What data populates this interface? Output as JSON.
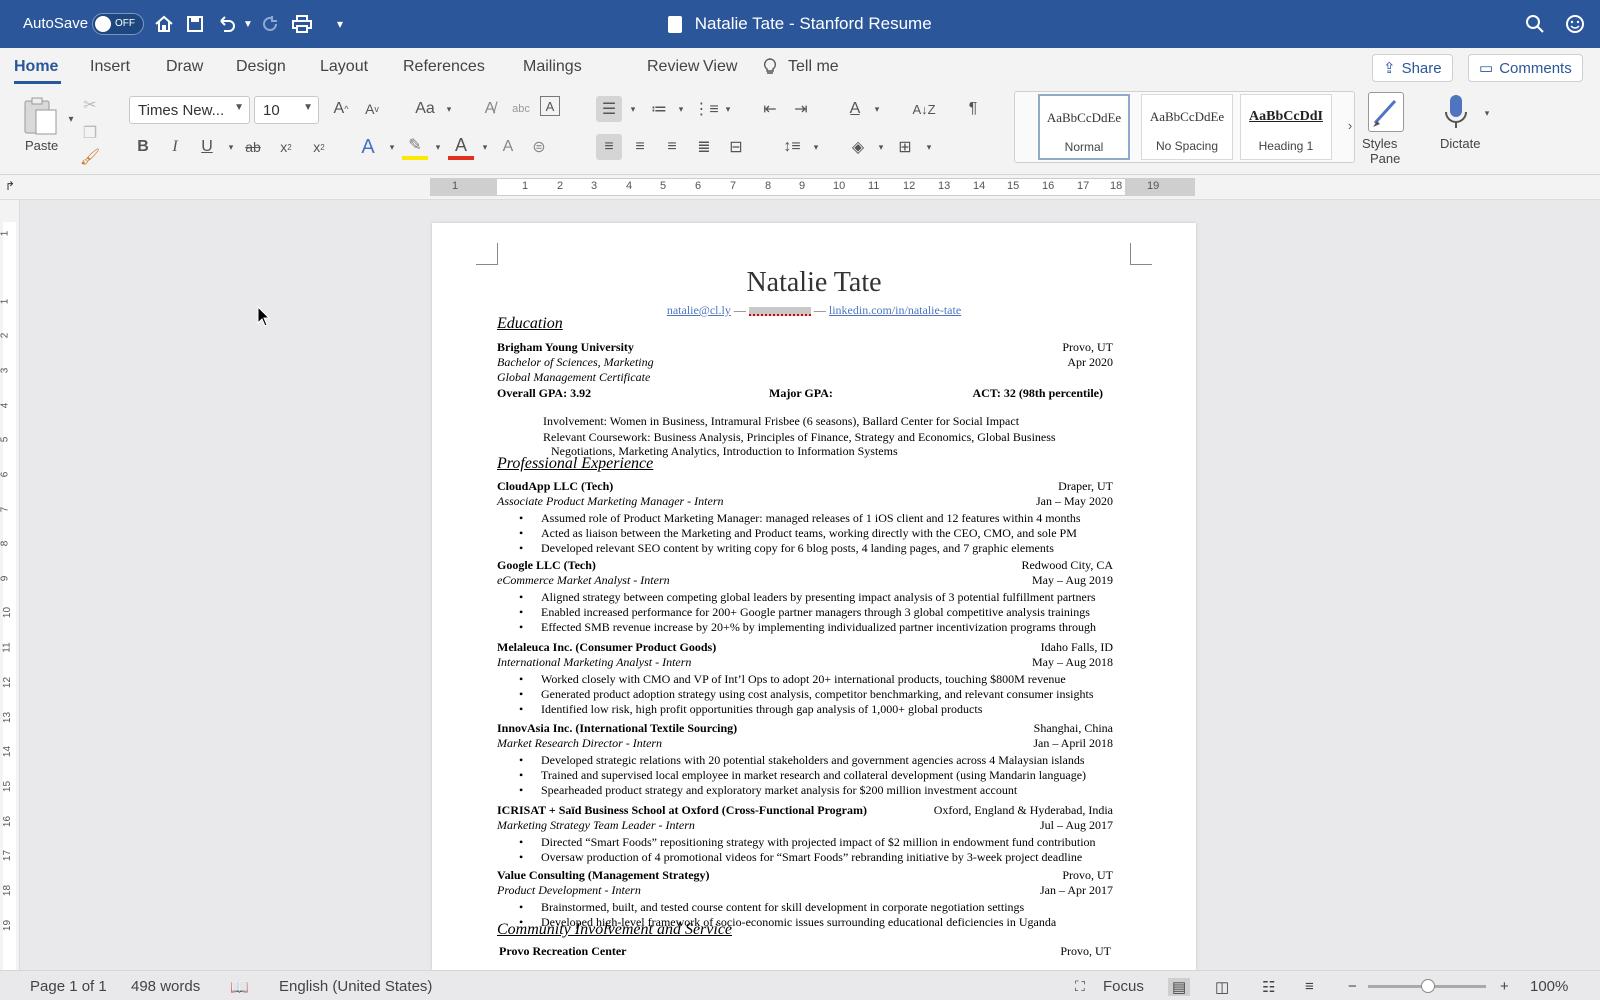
{
  "titlebar": {
    "autosave_label": "AutoSave",
    "toggle_state": "OFF",
    "doc_title": "Natalie Tate - Stanford Resume",
    "icons": [
      "home-icon",
      "save-icon",
      "undo-icon",
      "redo-icon",
      "print-icon",
      "customize-icon",
      "search-icon",
      "smiley-icon"
    ]
  },
  "tabs": [
    "Home",
    "Insert",
    "Draw",
    "Design",
    "Layout",
    "References",
    "Mailings",
    "Review",
    "View"
  ],
  "tell_me": "Tell me",
  "share_label": "Share",
  "comments_label": "Comments",
  "ribbon": {
    "paste_label": "Paste",
    "font_name": "Times New...",
    "font_size": "10",
    "styles": [
      {
        "sample": "AaBbCcDdEe",
        "name": "Normal"
      },
      {
        "sample": "AaBbCcDdEe",
        "name": "No Spacing"
      },
      {
        "sample": "AaBbCcDdI",
        "name": "Heading 1"
      }
    ],
    "styles_pane_label_1": "Styles",
    "styles_pane_label_2": "Pane",
    "dictate_label": "Dictate"
  },
  "ruler": {
    "numbers": [
      "1",
      "1",
      "2",
      "3",
      "4",
      "5",
      "6",
      "7",
      "8",
      "9",
      "10",
      "11",
      "12",
      "13",
      "14",
      "15",
      "16",
      "17",
      "18",
      "19"
    ],
    "vnumbers": [
      "1",
      "1",
      "2",
      "3",
      "4",
      "5",
      "6",
      "7",
      "8",
      "9",
      "10",
      "11",
      "12",
      "13",
      "14",
      "15",
      "16",
      "17",
      "18",
      "19"
    ]
  },
  "doc": {
    "name": "Natalie Tate",
    "email": "natalie@cl.ly",
    "sep1": " — ",
    "sep2": " — ",
    "linkedin": "linkedin.com/in/natalie-tate",
    "education_heading": "Education",
    "edu": {
      "school": "Brigham Young University",
      "location": "Provo, UT",
      "degree": "Bachelor of Sciences, Marketing",
      "date": "Apr 2020",
      "cert": "Global Management Certificate",
      "gpa": "Overall GPA: 3.92",
      "major_gpa": "Major GPA:",
      "act": "ACT: 32 (98th percentile)",
      "involvement": "Involvement: Women in Business, Intramural Frisbee (6 seasons), Ballard Center for Social Impact",
      "coursework_1": "Relevant Coursework: Business Analysis, Principles of Finance, Strategy and Economics, Global Business",
      "coursework_2": "Negotiations, Marketing Analytics, Introduction to Information Systems"
    },
    "experience_heading": "Professional Experience",
    "jobs": [
      {
        "company": "CloudApp LLC (Tech)",
        "location": "Draper, UT",
        "title": "Associate Product Marketing Manager - Intern",
        "dates": "Jan – May 2020",
        "bullets": [
          "Assumed role of Product Marketing Manager: managed releases of 1 iOS client and 12 features within 4 months",
          "Acted as liaison between the Marketing and Product teams, working directly with the CEO, CMO, and sole PM",
          "Developed relevant SEO content by writing copy for 6 blog posts, 4 landing pages, and 7 graphic elements"
        ]
      },
      {
        "company": "Google LLC (Tech)",
        "location": "Redwood City, CA",
        "title": "eCommerce Market Analyst - Intern",
        "dates": "May – Aug 2019",
        "bullets": [
          "Aligned strategy between competing global leaders by presenting impact analysis of 3 potential fulfillment partners",
          "Enabled increased performance for 200+ Google partner managers through 3 global competitive analysis trainings",
          "Effected SMB revenue increase by 20+% by implementing individualized partner incentivization programs through"
        ]
      },
      {
        "company": "Melaleuca Inc. (Consumer Product Goods)",
        "location": "Idaho Falls, ID",
        "title": "International Marketing Analyst - Intern",
        "dates": "May – Aug 2018",
        "bullets": [
          "Worked closely with CMO and VP of Int’l Ops to adopt 20+ international products, touching $800M revenue",
          "Generated product adoption strategy using cost analysis, competitor benchmarking, and relevant consumer insights",
          "Identified low risk, high profit opportunities through gap analysis of 1,000+ global products"
        ]
      },
      {
        "company": "InnovAsia Inc. (International Textile Sourcing)",
        "location": "Shanghai, China",
        "title": "Market Research Director - Intern",
        "dates": "Jan – April 2018",
        "bullets": [
          "Developed strategic relations with 20 potential stakeholders and government agencies across 4 Malaysian islands",
          "Trained and supervised local employee in market research and collateral development (using Mandarin language)",
          "Spearheaded product strategy and exploratory market analysis for $200 million investment account"
        ]
      },
      {
        "company": "ICRISAT + Saïd Business School at Oxford (Cross-Functional Program)",
        "location": "Oxford, England & Hyderabad, India",
        "title": "Marketing Strategy Team Leader - Intern",
        "dates": "Jul – Aug 2017",
        "bullets": [
          "Directed “Smart Foods” repositioning strategy with projected impact of $2 million in endowment fund contribution",
          "Oversaw production of 4 promotional videos for “Smart Foods” rebranding initiative by 3-week project deadline"
        ]
      },
      {
        "company": "Value Consulting (Management Strategy)",
        "location": "Provo, UT",
        "title": "Product Development - Intern",
        "dates": "Jan – Apr 2017",
        "bullets": [
          "Brainstormed, built, and tested course content for skill development in corporate negotiation settings",
          "Developed high-level framework of socio-economic issues surrounding educational deficiencies in Uganda"
        ]
      }
    ],
    "community_heading": "Community Involvement and Service",
    "community_org": "Provo Recreation Center",
    "community_location": "Provo, UT"
  },
  "status": {
    "page": "Page 1 of 1",
    "words": "498 words",
    "language": "English (United States)",
    "focus": "Focus",
    "zoom": "100%",
    "zoom_level_percent": 100
  }
}
